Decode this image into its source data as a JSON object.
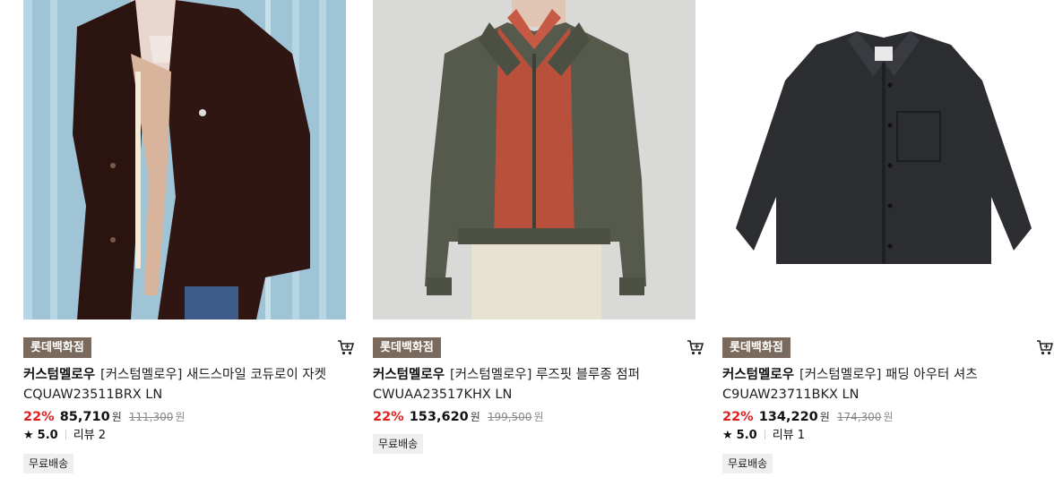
{
  "products": [
    {
      "store": "롯데백화점",
      "brand": "커스텀멜로우",
      "name": "[커스텀멜로우] 새드스마일 코듀로이 자켓",
      "code": "CQUAW23511BRX LN",
      "discount": "22%",
      "price": "85,710",
      "price_unit": "원",
      "original_price": "111,300",
      "original_unit": "원",
      "star": "★",
      "rating": "5.0",
      "reviews": "리뷰 2",
      "shipping": "무료배송"
    },
    {
      "store": "롯데백화점",
      "brand": "커스텀멜로우",
      "name": "[커스텀멜로우] 루즈핏 블루종 점퍼",
      "code": "CWUAA23517KHX LN",
      "discount": "22%",
      "price": "153,620",
      "price_unit": "원",
      "original_price": "199,500",
      "original_unit": "원",
      "shipping": "무료배송"
    },
    {
      "store": "롯데백화점",
      "brand": "커스텀멜로우",
      "name": "[커스텀멜로우] 패딩 아우터 셔츠",
      "code": "C9UAW23711BKX LN",
      "discount": "22%",
      "price": "134,220",
      "price_unit": "원",
      "original_price": "174,300",
      "original_unit": "원",
      "star": "★",
      "rating": "5.0",
      "reviews": "리뷰 1",
      "shipping": "무료배송"
    }
  ],
  "colors": {
    "store_badge_bg": "#7a6a5d",
    "discount": "#e02020",
    "shipping_badge_bg": "#efefef"
  },
  "icons": [
    "cart-icon",
    "star-icon"
  ]
}
